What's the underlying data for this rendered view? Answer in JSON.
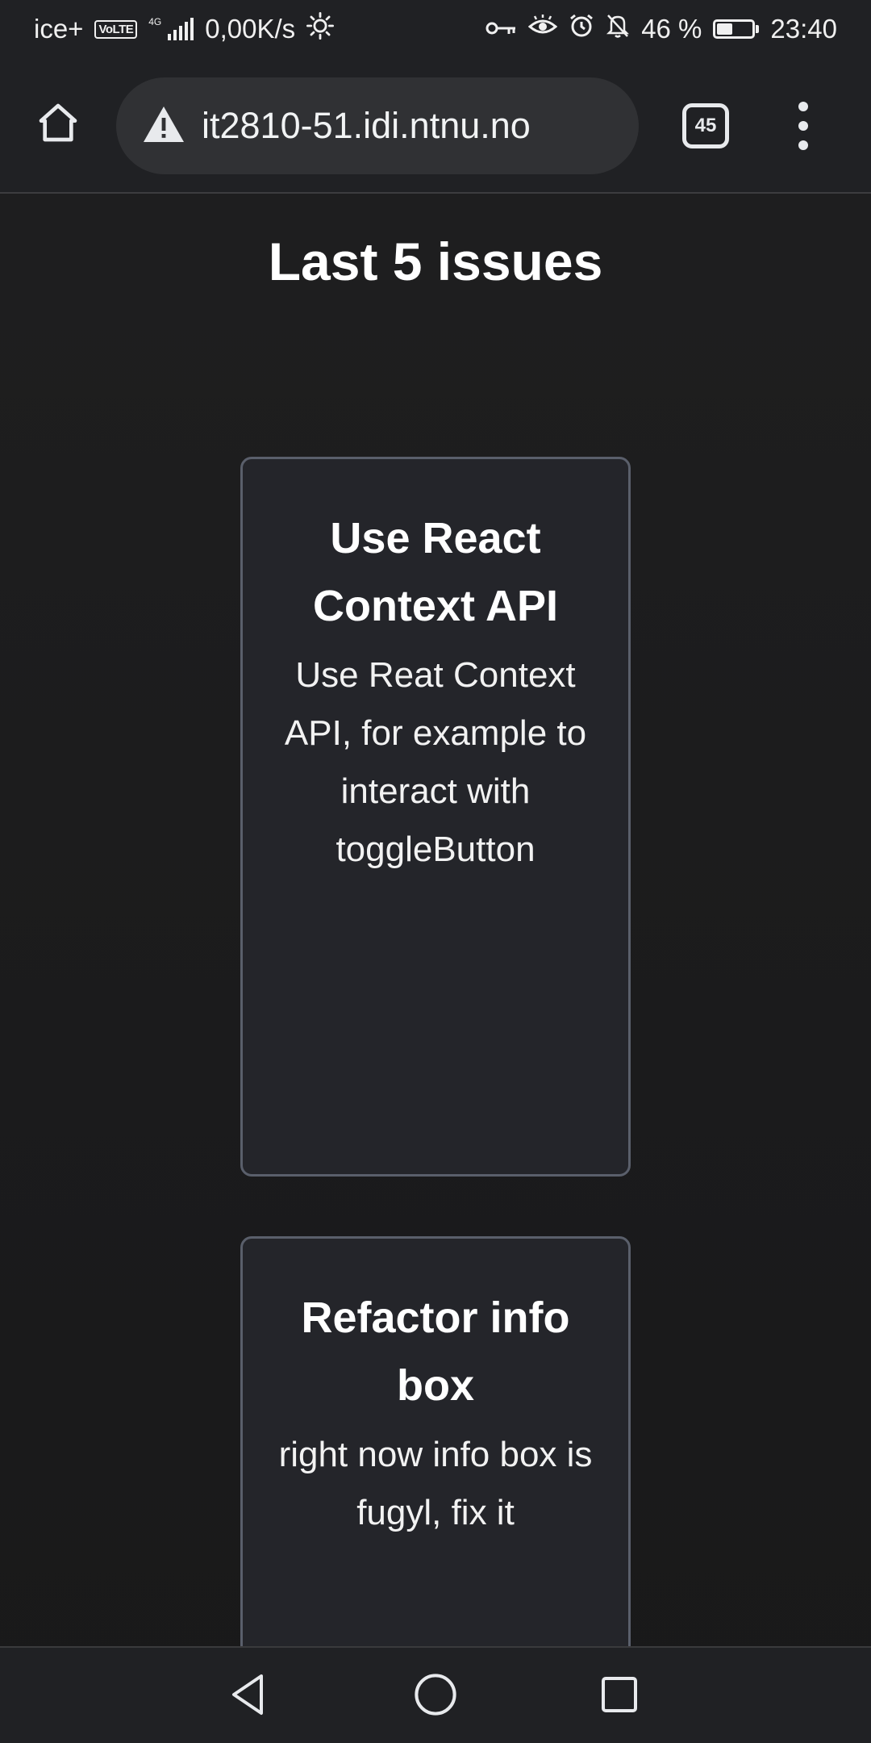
{
  "status_bar": {
    "carrier": "ice+",
    "volte": "VoLTE",
    "network": "4G",
    "speed": "0,00K/s",
    "battery_percent": "46 %",
    "battery_level": 0.46,
    "time": "23:40",
    "icons": [
      "brightness-icon",
      "vpn-key-icon",
      "eye-comfort-icon",
      "alarm-icon",
      "notifications-off-icon",
      "battery-icon"
    ]
  },
  "browser": {
    "url": "it2810-51.idi.ntnu.no",
    "tab_count": "45",
    "icons": [
      "home-icon",
      "not-secure-warning-icon",
      "tabs-icon",
      "more-vert-icon"
    ]
  },
  "page": {
    "title": "Last 5 issues",
    "issues": [
      {
        "title": "Use React Context API",
        "description": "Use Reat Context API, for example to interact with toggleButton"
      },
      {
        "title": "Refactor info box",
        "description": "right now info box is fugyl, fix it"
      }
    ]
  },
  "nav_bar": {
    "icons": [
      "back-icon",
      "home-circle-icon",
      "recents-icon"
    ]
  }
}
